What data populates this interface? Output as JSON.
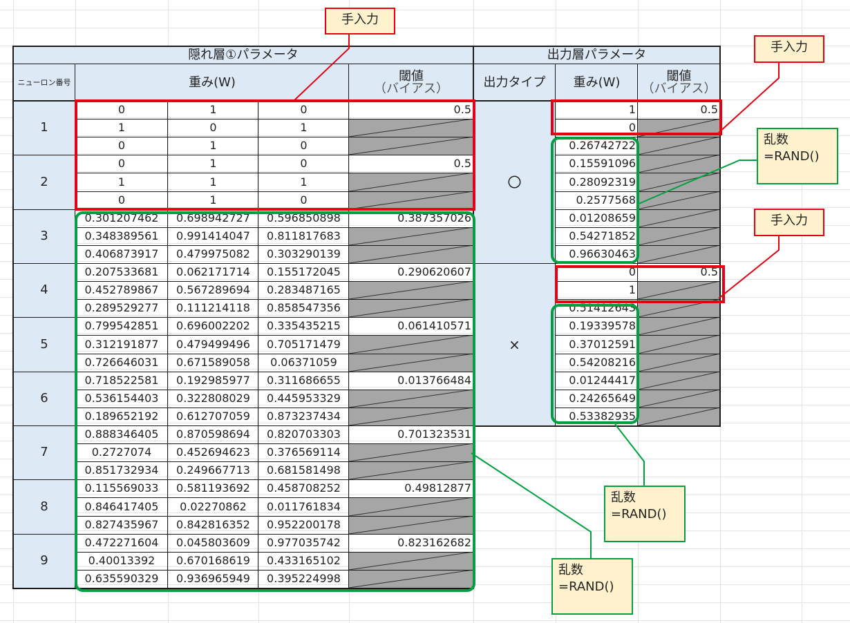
{
  "hidden_layer": {
    "title": "隠れ層①パラメータ",
    "neuron_header": "ニューロン番号",
    "weight_header": "重み(W)",
    "bias_header_1": "閾値",
    "bias_header_2": "（バイアス）",
    "neurons": [
      {
        "label": "1",
        "weights": [
          [
            "0",
            "1",
            "0"
          ],
          [
            "1",
            "0",
            "1"
          ],
          [
            "0",
            "1",
            "0"
          ]
        ],
        "bias": "0.5"
      },
      {
        "label": "2",
        "weights": [
          [
            "0",
            "1",
            "0"
          ],
          [
            "1",
            "1",
            "1"
          ],
          [
            "0",
            "1",
            "0"
          ]
        ],
        "bias": "0.5"
      },
      {
        "label": "3",
        "weights": [
          [
            "0.301207462",
            "0.698942727",
            "0.596850898"
          ],
          [
            "0.348389561",
            "0.991414047",
            "0.811817683"
          ],
          [
            "0.406873917",
            "0.479975082",
            "0.303290139"
          ]
        ],
        "bias": "0.387357026"
      },
      {
        "label": "4",
        "weights": [
          [
            "0.207533681",
            "0.062171714",
            "0.155172045"
          ],
          [
            "0.452789867",
            "0.567289694",
            "0.283487165"
          ],
          [
            "0.289529277",
            "0.111214118",
            "0.858547356"
          ]
        ],
        "bias": "0.290620607"
      },
      {
        "label": "5",
        "weights": [
          [
            "0.799542851",
            "0.696002202",
            "0.335435215"
          ],
          [
            "0.312191877",
            "0.479499496",
            "0.705171479"
          ],
          [
            "0.726646031",
            "0.671589058",
            "0.06371059"
          ]
        ],
        "bias": "0.061410571"
      },
      {
        "label": "6",
        "weights": [
          [
            "0.718522581",
            "0.192985977",
            "0.311686655"
          ],
          [
            "0.536154403",
            "0.322808029",
            "0.445953329"
          ],
          [
            "0.189652192",
            "0.612707059",
            "0.873237434"
          ]
        ],
        "bias": "0.013766484"
      },
      {
        "label": "7",
        "weights": [
          [
            "0.888346405",
            "0.870598694",
            "0.820703303"
          ],
          [
            "0.2727074",
            "0.452694623",
            "0.376569114"
          ],
          [
            "0.851732934",
            "0.249667713",
            "0.681581498"
          ]
        ],
        "bias": "0.701323531"
      },
      {
        "label": "8",
        "weights": [
          [
            "0.115569033",
            "0.581193692",
            "0.458708252"
          ],
          [
            "0.846417405",
            "0.02270862",
            "0.011761834"
          ],
          [
            "0.827435967",
            "0.842816352",
            "0.952200178"
          ]
        ],
        "bias": "0.49812877"
      },
      {
        "label": "9",
        "weights": [
          [
            "0.472271604",
            "0.045803609",
            "0.977035742"
          ],
          [
            "0.40013392",
            "0.670168619",
            "0.433165102"
          ],
          [
            "0.635590329",
            "0.936965949",
            "0.395224998"
          ]
        ],
        "bias": "0.823162682"
      }
    ]
  },
  "output_layer": {
    "title": "出力層パラメータ",
    "type_header": "出力タイプ",
    "weight_header": "重み(W)",
    "bias_header_1": "閾値",
    "bias_header_2": "（バイアス）",
    "types": [
      {
        "label": "〇",
        "weights": [
          "1",
          "0",
          "0.26742722",
          "0.15591096",
          "0.28092319",
          "0.2577568",
          "0.01208659",
          "0.54271852",
          "0.96630463"
        ],
        "bias": "0.5"
      },
      {
        "label": "×",
        "weights": [
          "0",
          "1",
          "0.51412643",
          "0.19339578",
          "0.37012591",
          "0.54208216",
          "0.01244417",
          "0.24265649",
          "0.53382935"
        ],
        "bias": "0.5"
      }
    ]
  },
  "callouts": {
    "manual_1": "手入力",
    "manual_2": "手入力",
    "manual_3": "手入力",
    "random_1_title": "乱数",
    "random_1_formula": "=RAND()",
    "random_2_title": "乱数",
    "random_2_formula": "=RAND()",
    "random_3_title": "乱数",
    "random_3_formula": "=RAND()"
  },
  "colors": {
    "header_bg": "#dde9f5",
    "gray_cell": "#a6a6a6",
    "manual_highlight": "#e60012",
    "random_highlight": "#00a040",
    "callout_bg": "#fff2cc"
  }
}
